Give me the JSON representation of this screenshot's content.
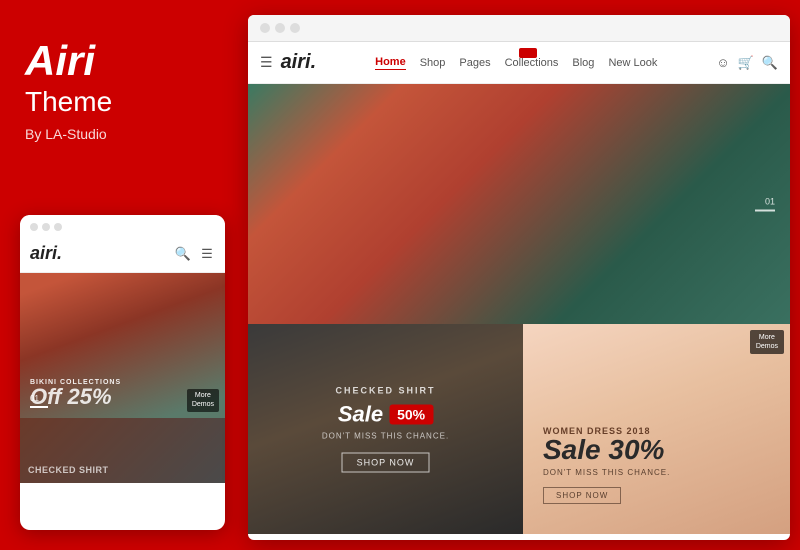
{
  "sidebar": {
    "brand": "Airi",
    "theme_label": "Theme",
    "by_label": "By LA-Studio"
  },
  "mobile_mockup": {
    "dots": [
      "dot1",
      "dot2",
      "dot3"
    ],
    "logo": "airi.",
    "bikini_text": "BIKINI COLLECTIONS",
    "sale_text": "Off 25%",
    "page_num": "01",
    "more_demos": "More\nDemos",
    "bottom_text": "CHECKED SHIRT"
  },
  "browser": {
    "dots": [
      "dot1",
      "dot2",
      "dot3"
    ]
  },
  "nav": {
    "logo": "airi.",
    "links": [
      {
        "label": "Home",
        "active": true
      },
      {
        "label": "Shop",
        "active": false
      },
      {
        "label": "Pages",
        "active": false
      },
      {
        "label": "Collections",
        "active": false
      },
      {
        "label": "Blog",
        "active": false
      },
      {
        "label": "New Look",
        "active": false
      }
    ]
  },
  "hero": {
    "page_num": "01"
  },
  "bottom_left": {
    "label": "CHECKED SHIRT",
    "sale_word": "Sale",
    "sale_pct": "50%",
    "miss_text": "DON'T MISS THIS CHANCE.",
    "shop_btn": "Shop Now"
  },
  "bottom_right": {
    "label": "Women Dress 2018",
    "sale_text": "Sale 30%",
    "miss_text": "DON'T MISS THIS CHANCE.",
    "shop_btn": "Shop Now",
    "more_demos": "More\nDemos"
  }
}
